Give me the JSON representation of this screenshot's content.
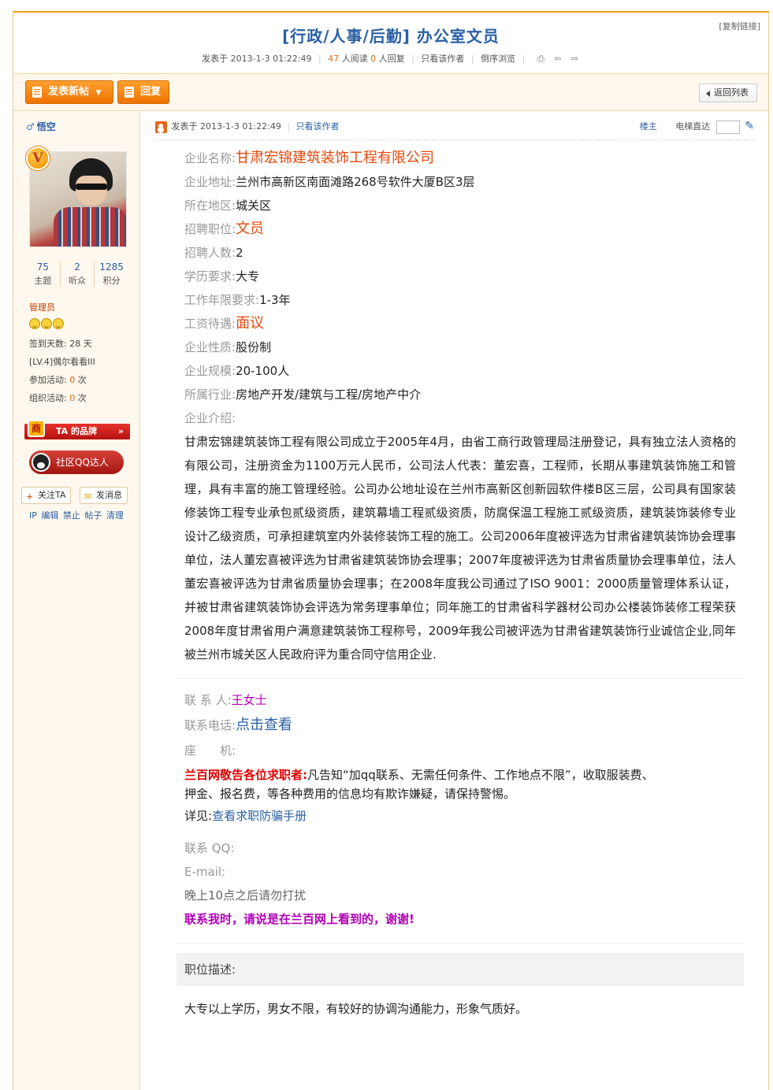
{
  "header": {
    "copy_link": "[复制链接]",
    "title": "[行政/人事/后勤] 办公室文员",
    "posted_label": "发表于",
    "posted_time": "2013-1-3 01:22:49",
    "views": "47",
    "views_label": "人阅读",
    "replies": "0",
    "replies_label": "人回复",
    "only_author": "只看该作者",
    "reverse_browse": "倒序浏览"
  },
  "toolbar": {
    "new_post": "发表新帖",
    "reply": "回复",
    "back_list": "返回列表"
  },
  "user": {
    "name": "悟空",
    "vip_badge": "V",
    "stats": [
      {
        "value": "75",
        "label": "主题"
      },
      {
        "value": "2",
        "label": "听众"
      },
      {
        "value": "1285",
        "label": "积分"
      }
    ],
    "role": "管理员",
    "checkin_label": "签到天数:",
    "checkin_value": "28 天",
    "level": "[LV.4]偶尔看看III",
    "join_label": "参加活动:",
    "join_value": "0",
    "org_label": "组织活动:",
    "org_value": "0",
    "times_unit": "次",
    "brand_mark": "商",
    "brand": "TA 的品牌",
    "brand_arrow": "»",
    "qq": "社区QQ达人",
    "follow": "关注TA",
    "message": "发消息",
    "admin_links": "IP 编辑 禁止 帖子 清理"
  },
  "post": {
    "posted_label": "发表于",
    "posted_time": "2013-1-3 01:22:49",
    "only_author": "只看该作者",
    "floor": "楼主",
    "elevator": "电梯直达",
    "fields": {
      "company_label": "企业名称:",
      "company": "甘肃宏锦建筑装饰工程有限公司",
      "address_label": "企业地址:",
      "address": "兰州市高新区南面滩路268号软件大厦B区3层",
      "region_label": "所在地区:",
      "region": "城关区",
      "position_label": "招聘职位:",
      "position": "文员",
      "count_label": "招聘人数:",
      "count": "2",
      "education_label": "学历要求:",
      "education": "大专",
      "experience_label": "工作年限要求:",
      "experience": "1-3年",
      "salary_label": "工资待遇:",
      "salary": "面议",
      "nature_label": "企业性质:",
      "nature": "股份制",
      "scale_label": "企业规模:",
      "scale": "20-100人",
      "industry_label": "所属行业:",
      "industry": "房地产开发/建筑与工程/房地产中介",
      "intro_label": "企业介绍:"
    },
    "intro": "甘肃宏锦建筑装饰工程有限公司成立于2005年4月，由省工商行政管理局注册登记，具有独立法人资格的有限公司，注册资金为1100万元人民币，公司法人代表：董宏喜，工程师，长期从事建筑装饰施工和管理，具有丰富的施工管理经验。公司办公地址设在兰州市高新区创新园软件楼B区三层，公司具有国家装修装饰工程专业承包贰级资质，建筑幕墙工程贰级资质，防腐保温工程施工贰级资质，建筑装饰装修专业设计乙级资质，可承担建筑室内外装修装饰工程的施工。公司2006年度被评选为甘肃省建筑装饰协会理事单位，法人董宏喜被评选为甘肃省建筑装饰协会理事；2007年度被评选为甘肃省质量协会理事单位，法人董宏喜被评选为甘肃省质量协会理事；在2008年度我公司通过了ISO 9001：2000质量管理体系认证，并被甘肃省建筑装饰协会评选为常务理事单位；同年施工的甘肃省科学器材公司办公楼装饰装修工程荣获2008年度甘肃省用户满意建筑装饰工程称号，2009年我公司被评选为甘肃省建筑装饰行业诚信企业,同年被兰州市城关区人民政府评为重合同守信用企业.",
    "contact": {
      "person_label": "联 系 人:",
      "person": "王女士",
      "phone_label": "联系电话:",
      "phone": "点击查看",
      "landline_label": "座　　机:",
      "warn_title": "兰百网敬告各位求职者:",
      "warn_text": "凡告知“加qq联系、无需任何条件、工作地点不限”，收取服装费、押金、报名费，等各种费用的信息均有欺诈嫌疑，请保持警惕。",
      "detail_label": "详见:",
      "detail_link": "查看求职防骗手册",
      "qq_label": "联系 QQ:",
      "email_label": " E-mail:",
      "note": "晚上10点之后请勿打扰",
      "thanks": "联系我时，请说是在兰百网上看到的，谢谢!"
    },
    "desc_title": "职位描述:",
    "desc_body": "大专以上学历，男女不限，有较好的协调沟通能力，形象气质好。"
  }
}
